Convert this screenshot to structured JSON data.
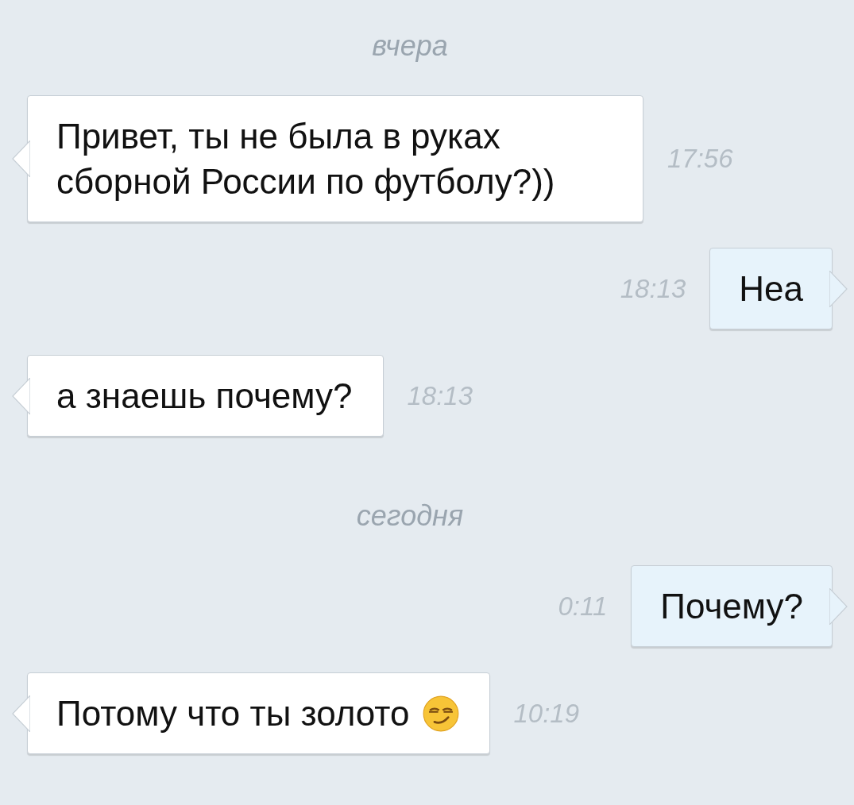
{
  "messages": [
    {
      "kind": "date",
      "text": "вчера"
    },
    {
      "kind": "incoming",
      "text": "Привет, ты не была в руках сборной России по футболу?))",
      "time": "17:56"
    },
    {
      "kind": "outgoing",
      "text": "Неа",
      "time": "18:13"
    },
    {
      "kind": "incoming",
      "text": "а знаешь почему?",
      "time": "18:13"
    },
    {
      "kind": "date",
      "text": "сегодня"
    },
    {
      "kind": "outgoing",
      "text": "Почему?",
      "time": "0:11"
    },
    {
      "kind": "incoming-smiley",
      "text": "Потому что ты золото",
      "time": "10:19"
    }
  ]
}
